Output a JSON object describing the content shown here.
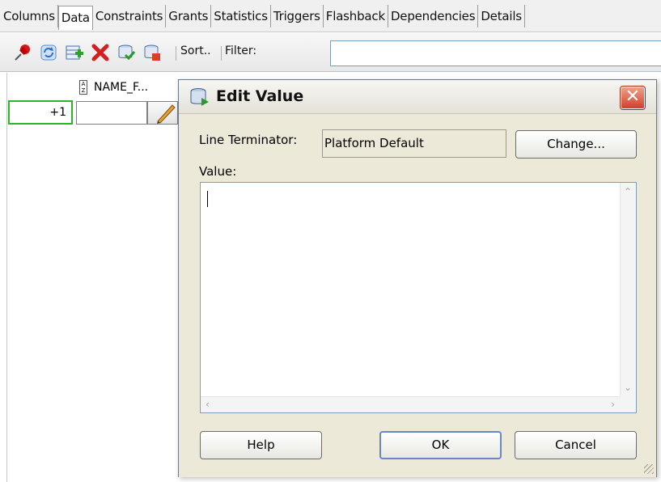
{
  "tabs": [
    {
      "label": "Columns",
      "active": false
    },
    {
      "label": "Data",
      "active": true
    },
    {
      "label": "Constraints",
      "active": false
    },
    {
      "label": "Grants",
      "active": false
    },
    {
      "label": "Statistics",
      "active": false
    },
    {
      "label": "Triggers",
      "active": false
    },
    {
      "label": "Flashback",
      "active": false
    },
    {
      "label": "Dependencies",
      "active": false
    },
    {
      "label": "Details",
      "active": false
    }
  ],
  "toolbar": {
    "icons": [
      "freeze-pin-icon",
      "refresh-icon",
      "insert-row-icon",
      "delete-row-icon",
      "commit-icon",
      "rollback-icon"
    ],
    "sort_label": "Sort..",
    "filter_label": "Filter:",
    "filter_value": ""
  },
  "grid": {
    "column_header": "NAME_F...",
    "row_label": "+1",
    "cell_value": ""
  },
  "dialog": {
    "title": "Edit Value",
    "line_terminator_label": "Line Terminator:",
    "line_terminator_value": "Platform Default",
    "change_button": "Change...",
    "value_label": "Value:",
    "value_text": "",
    "help_button": "Help",
    "ok_button": "OK",
    "cancel_button": "Cancel"
  },
  "colors": {
    "dialog_bg": "#ece9d8",
    "close_red": "#d0402a",
    "new_row_border": "#2bb52b",
    "input_border": "#7f9db9"
  }
}
